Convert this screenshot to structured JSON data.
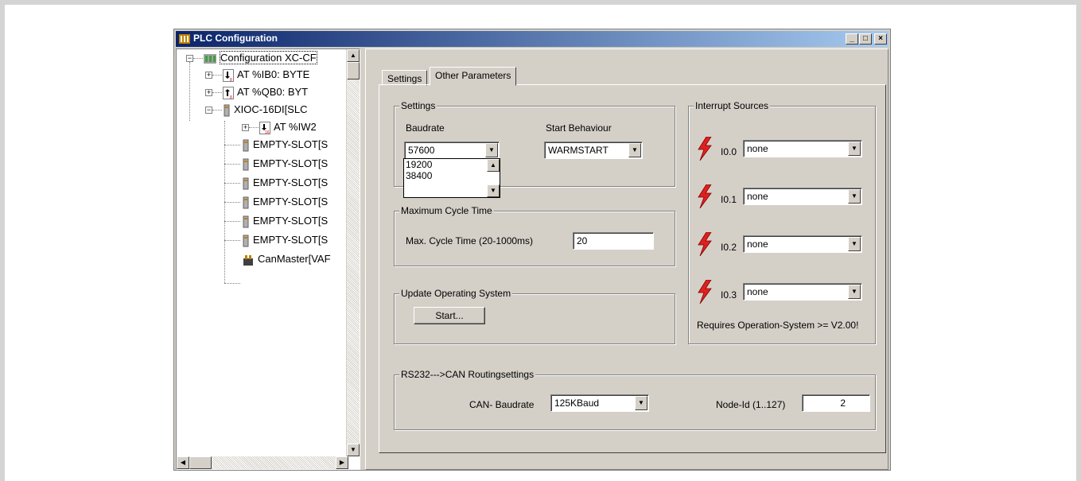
{
  "window": {
    "title": "PLC Configuration",
    "minimize": "_",
    "maximize": "□",
    "close": "×"
  },
  "tree": {
    "root": "Configuration XC-CF",
    "items": [
      {
        "label": "AT %IB0: BYTE",
        "icon": "input-byte-icon"
      },
      {
        "label": "AT %QB0: BYT",
        "icon": "output-byte-icon"
      },
      {
        "label": "XIOC-16DI[SLC",
        "icon": "module-icon"
      },
      {
        "label": "AT %IW2",
        "icon": "input-word-icon"
      },
      {
        "label": "EMPTY-SLOT[S",
        "icon": "module-icon"
      },
      {
        "label": "EMPTY-SLOT[S",
        "icon": "module-icon"
      },
      {
        "label": "EMPTY-SLOT[S",
        "icon": "module-icon"
      },
      {
        "label": "EMPTY-SLOT[S",
        "icon": "module-icon"
      },
      {
        "label": "EMPTY-SLOT[S",
        "icon": "module-icon"
      },
      {
        "label": "EMPTY-SLOT[S",
        "icon": "module-icon"
      },
      {
        "label": "CanMaster[VAF",
        "icon": "can-master-icon"
      }
    ]
  },
  "tabs": [
    {
      "label": "Settings"
    },
    {
      "label": "Other Parameters"
    }
  ],
  "settings_group": {
    "title": "Settings",
    "baudrate_label": "Baudrate",
    "baudrate_value": "57600",
    "baudrate_options": [
      "19200",
      "38400"
    ],
    "start_behaviour_label": "Start Behaviour",
    "start_behaviour_value": "WARMSTART"
  },
  "cycle_group": {
    "title": "Maximum Cycle Time",
    "label": "Max. Cycle Time (20-1000ms)",
    "value": "20"
  },
  "update_group": {
    "title": "Update Operating System",
    "button": "Start..."
  },
  "interrupt_group": {
    "title": "Interrupt Sources",
    "items": [
      {
        "label": "I0.0",
        "value": "none"
      },
      {
        "label": "I0.1",
        "value": "none"
      },
      {
        "label": "I0.2",
        "value": "none"
      },
      {
        "label": "I0.3",
        "value": "none"
      }
    ],
    "note": "Requires Operation-System >= V2.00!"
  },
  "routing_group": {
    "title": "RS232--->CAN Routingsettings",
    "can_baudrate_label": "CAN- Baudrate",
    "can_baudrate_value": "125KBaud",
    "node_id_label": "Node-Id (1..127)",
    "node_id_value": "2"
  },
  "colors": {
    "titlebar_start": "#0a246a",
    "titlebar_end": "#a6caf0",
    "face": "#d4d0c8",
    "bolt": "#e02020"
  }
}
